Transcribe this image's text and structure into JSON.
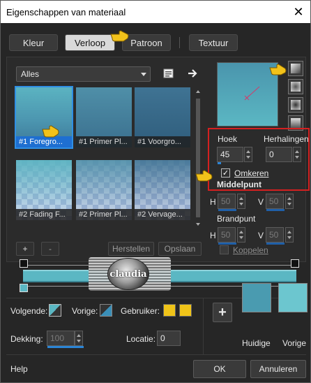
{
  "window": {
    "title": "Eigenschappen van materiaal",
    "close_glyph": "✕"
  },
  "tabs": [
    {
      "label": "Kleur",
      "active": false
    },
    {
      "label": "Verloop",
      "active": true
    },
    {
      "label": "Patroon",
      "active": false
    },
    {
      "label": "Textuur",
      "active": false
    }
  ],
  "library": {
    "category_value": "Alles",
    "swatches": [
      {
        "label": "#1 Foregro...",
        "selected": true
      },
      {
        "label": "#1 Primer Pl...",
        "selected": false
      },
      {
        "label": "#1 Voorgro...",
        "selected": false
      },
      {
        "label": "#2 Fading F...",
        "selected": false
      },
      {
        "label": "#2 Primer Pl...",
        "selected": false
      },
      {
        "label": "#2 Vervage...",
        "selected": false
      }
    ],
    "add_label": "+",
    "remove_label": "-",
    "reset_label": "Herstellen",
    "save_label": "Opslaan"
  },
  "angle": {
    "label": "Hoek",
    "value": "45",
    "fill_fraction": 0.125
  },
  "repeats": {
    "label": "Herhalingen",
    "value": "0"
  },
  "invert": {
    "label": "Omkeren",
    "checked": true
  },
  "midpoint": {
    "label": "Middelpunt",
    "h_label": "H",
    "h_value": "50",
    "v_label": "V",
    "v_value": "50"
  },
  "focalpoint": {
    "label": "Brandpunt",
    "h_label": "H",
    "h_value": "50",
    "v_label": "V",
    "v_value": "50",
    "link_label": "Koppelen"
  },
  "watermark": {
    "text": "claudia"
  },
  "colors": {
    "next_label": "Volgende:",
    "previous_label": "Vorige:",
    "user_label": "Gebruiker:",
    "user_color": "#f0c419",
    "gradient_color": "#5bb7c3",
    "current_label": "Huidige",
    "previous_swatch_label": "Vorige",
    "current_color": "#4a9bb0",
    "previous_color": "#6cc6cf"
  },
  "opacity": {
    "label": "Dekking:",
    "value": "100",
    "fill_fraction": 1.0
  },
  "location": {
    "label": "Locatie:",
    "value": "0"
  },
  "footer": {
    "help": "Help",
    "ok": "OK",
    "cancel": "Annuleren"
  },
  "accent": "#2f8fe4",
  "highlight_border": "#d42020"
}
